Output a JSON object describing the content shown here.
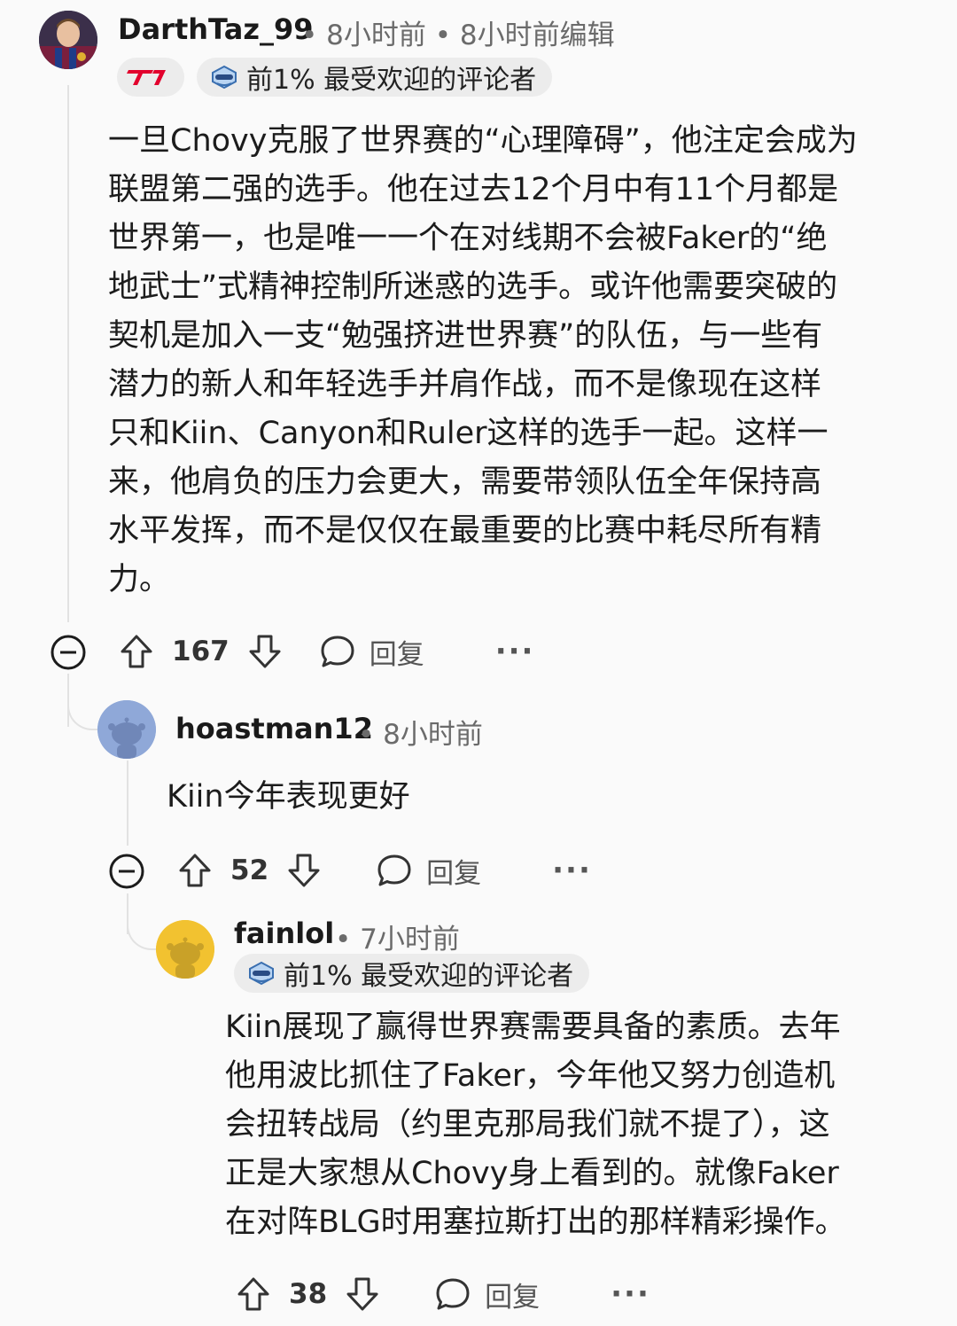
{
  "comments": [
    {
      "username": "DarthTaz_99",
      "meta": "• 8小时前 • 8小时前编辑",
      "flair_badge": "T1",
      "top_badge": "前1% 最受欢迎的评论者",
      "body_lines": [
        "一旦Chovy克服了世界赛的“心理障碍”，他注定会成为",
        "联盟第二强的选手。他在过去12个月中有11个月都是",
        "世界第一，也是唯一一个在对线期不会被Faker的“绝",
        "地武士”式精神控制所迷惑的选手。或许他需要突破的",
        "契机是加入一支“勉强挤进世界赛”的队伍，与一些有",
        "潜力的新人和年轻选手并肩作战，而不是像现在这样",
        "只和Kiin、Canyon和Ruler这样的选手一起。这样一",
        "来，他肩负的压力会更大，需要带领队伍全年保持高",
        "水平发挥，而不是仅仅在最重要的比赛中耗尽所有精",
        "力。"
      ],
      "votes": "167",
      "reply": "回复",
      "more": "···"
    },
    {
      "username": "hoastman12",
      "meta": "• 8小时前",
      "body_lines": [
        "Kiin今年表现更好"
      ],
      "votes": "52",
      "reply": "回复",
      "more": "···"
    },
    {
      "username": "fainlol",
      "meta": "• 7小时前",
      "top_badge": "前1% 最受欢迎的评论者",
      "body_lines": [
        "Kiin展现了赢得世界赛需要具备的素质。去年",
        "他用波比抓住了Faker，今年他又努力创造机",
        "会扭转战局（约里克那局我们就不提了），这",
        "正是大家想从Chovy身上看到的。就像Faker",
        "在对阵BLG时用塞拉斯打出的那样精彩操作。"
      ],
      "votes": "38",
      "reply": "回复",
      "more": "···"
    }
  ],
  "colors": {
    "background": "#fafafa",
    "thread_line": "#e2e2e2",
    "badge_bg": "#ececec",
    "t1_red": "#e2012d",
    "snoo_blue": "#8fa8d8",
    "snoo_yellow": "#f2c230"
  },
  "icons": {
    "collapse": "minus-circle-icon",
    "upvote": "arrow-up-icon",
    "downvote": "arrow-down-icon",
    "reply": "speech-bubble-icon",
    "more": "ellipsis-icon",
    "top_commenter": "top-commenter-badge-icon"
  }
}
